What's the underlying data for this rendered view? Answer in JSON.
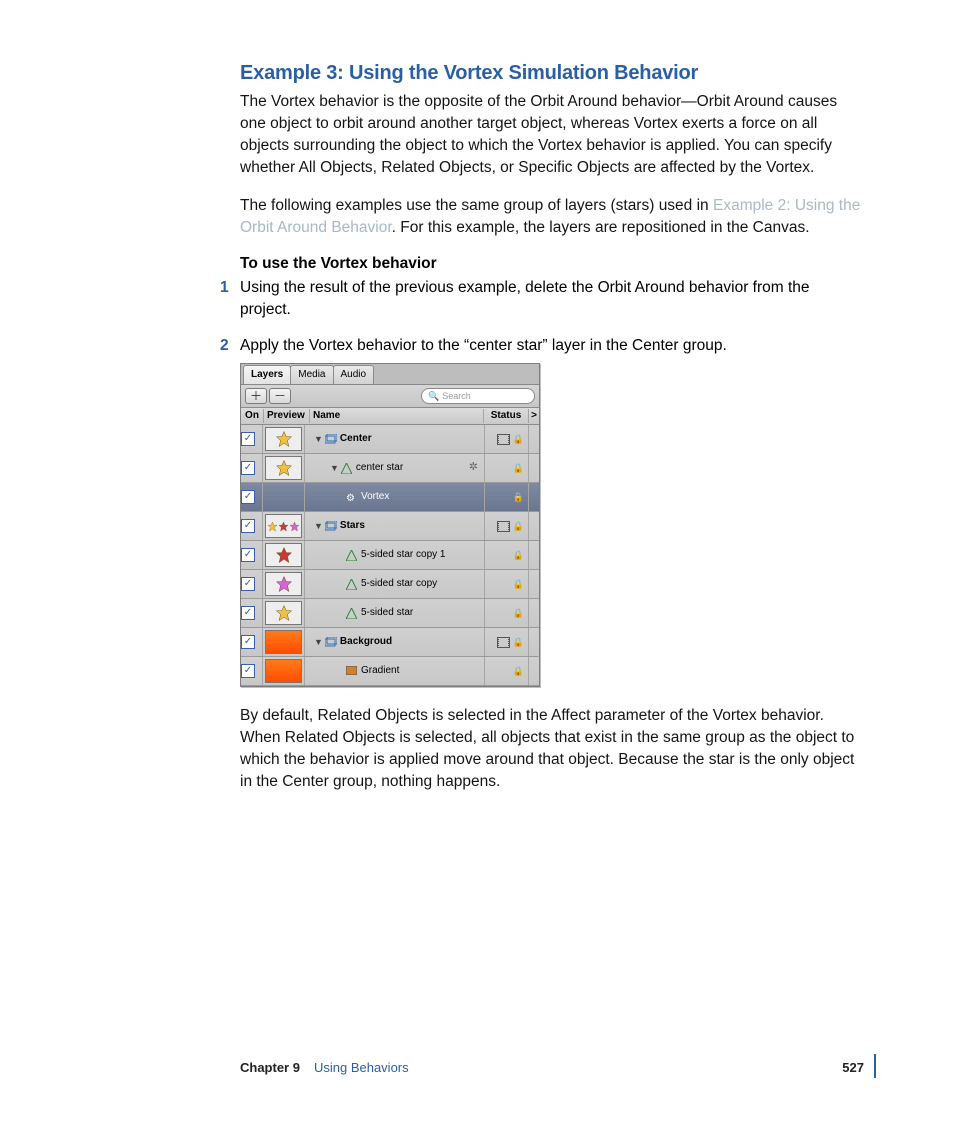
{
  "heading": "Example 3: Using the Vortex Simulation Behavior",
  "para1": "The Vortex behavior is the opposite of the Orbit Around behavior—Orbit Around causes one object to orbit around another target object, whereas Vortex exerts a force on all objects surrounding the object to which the Vortex behavior is applied. You can specify whether All Objects, Related Objects, or Specific Objects are affected by the Vortex.",
  "para2_a": "The following examples use the same group of layers (stars) used in ",
  "para2_link": "Example 2: Using the Orbit Around Behavior",
  "para2_b": ". For this example, the layers are repositioned in the Canvas.",
  "subhead": "To use the Vortex behavior",
  "step1": "Using the result of the previous example, delete the Orbit Around behavior from the project.",
  "step2": "Apply the Vortex behavior to the “center star” layer in the Center group.",
  "para3": "By default, Related Objects is selected in the Affect parameter of the Vortex behavior. When Related Objects is selected, all objects that exist in the same group as the object to which the behavior is applied move around that object. Because the star is the only object in the Center group, nothing happens.",
  "panel": {
    "tabs": [
      "Layers",
      "Media",
      "Audio"
    ],
    "search_placeholder": "Search",
    "cols": {
      "on": "On",
      "preview": "Preview",
      "name": "Name",
      "status": "Status",
      "ext": ">"
    },
    "rows": [
      {
        "name": "Center",
        "indent": 0,
        "group": true,
        "thumb": "gold-star",
        "has_gear": false,
        "has_strip": true
      },
      {
        "name": "center star",
        "indent": 1,
        "group": false,
        "thumb": "gold-star",
        "has_gear": true,
        "has_strip": false
      },
      {
        "name": "Vortex",
        "indent": 2,
        "group": false,
        "thumb": "none",
        "selected": true,
        "icon": "gear",
        "has_gear": false,
        "has_strip": false
      },
      {
        "name": "Stars",
        "indent": 0,
        "group": true,
        "thumb": "three-star",
        "has_gear": false,
        "has_strip": true
      },
      {
        "name": "5-sided star copy 1",
        "indent": 2,
        "group": false,
        "thumb": "red-star",
        "has_gear": false,
        "has_strip": false,
        "shape": true
      },
      {
        "name": "5-sided star copy",
        "indent": 2,
        "group": false,
        "thumb": "magenta-star",
        "has_gear": false,
        "has_strip": false,
        "shape": true
      },
      {
        "name": "5-sided star",
        "indent": 2,
        "group": false,
        "thumb": "gold-star",
        "has_gear": false,
        "has_strip": false,
        "shape": true
      },
      {
        "name": "Backgroud",
        "indent": 0,
        "group": true,
        "thumb": "orange-rect",
        "has_gear": false,
        "has_strip": true
      },
      {
        "name": "Gradient",
        "indent": 2,
        "group": false,
        "thumb": "orange-rect",
        "has_gear": false,
        "has_strip": false,
        "grad": true
      }
    ]
  },
  "footer": {
    "chapter": "Chapter 9",
    "title": "Using Behaviors",
    "page": "527"
  }
}
